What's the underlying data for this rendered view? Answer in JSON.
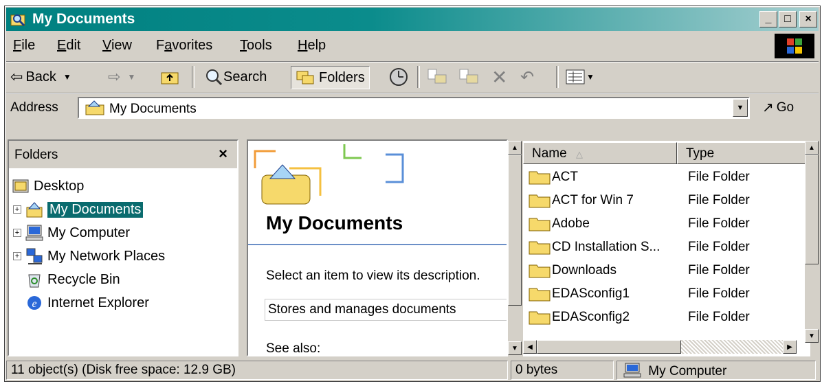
{
  "window": {
    "title": "My Documents",
    "minimize": "_",
    "maximize": "□",
    "close": "×"
  },
  "menu": [
    {
      "label": "File",
      "key": "F",
      "rest": "ile"
    },
    {
      "label": "Edit",
      "key": "E",
      "rest": "dit"
    },
    {
      "label": "View",
      "key": "V",
      "rest": "iew"
    },
    {
      "label": "Favorites",
      "pre": "F",
      "key": "a",
      "rest": "vorites"
    },
    {
      "label": "Tools",
      "key": "T",
      "rest": "ools"
    },
    {
      "label": "Help",
      "key": "H",
      "rest": "elp"
    }
  ],
  "toolbar": {
    "back_label": "Back",
    "search_label": "Search",
    "folders_label": "Folders"
  },
  "address": {
    "label": "Address",
    "value": "My Documents",
    "go_label": "Go"
  },
  "folders_pane": {
    "title": "Folders",
    "close": "×",
    "tree": [
      {
        "label": "Desktop",
        "icon": "desktop-icon"
      },
      {
        "label": "My Documents",
        "icon": "my-documents-icon",
        "selected": true
      },
      {
        "label": "My Computer",
        "icon": "my-computer-icon"
      },
      {
        "label": "My Network Places",
        "icon": "network-places-icon"
      },
      {
        "label": "Recycle Bin",
        "icon": "recycle-bin-icon"
      },
      {
        "label": "Internet Explorer",
        "icon": "internet-explorer-icon"
      }
    ]
  },
  "task_pane": {
    "title": "My Documents",
    "prompt": "Select an item to view its description.",
    "description": "Stores and manages documents",
    "see_also": "See also:"
  },
  "file_list": {
    "columns": {
      "name": "Name",
      "type": "Type"
    },
    "rows": [
      {
        "name": "ACT",
        "type": "File Folder"
      },
      {
        "name": "ACT for Win 7",
        "type": "File Folder"
      },
      {
        "name": "Adobe",
        "type": "File Folder"
      },
      {
        "name": "CD Installation S...",
        "type": "File Folder"
      },
      {
        "name": "Downloads",
        "type": "File Folder"
      },
      {
        "name": "EDASconfig1",
        "type": "File Folder"
      },
      {
        "name": "EDASconfig2",
        "type": "File Folder"
      }
    ]
  },
  "status": {
    "objects": "11 object(s) (Disk free space: 12.9 GB)",
    "size": "0 bytes",
    "zone": "My Computer"
  },
  "colors": {
    "title_start": "#008080",
    "selection": "#0a6b6e",
    "face": "#d4d0c8",
    "folder": "#f6d96b"
  }
}
